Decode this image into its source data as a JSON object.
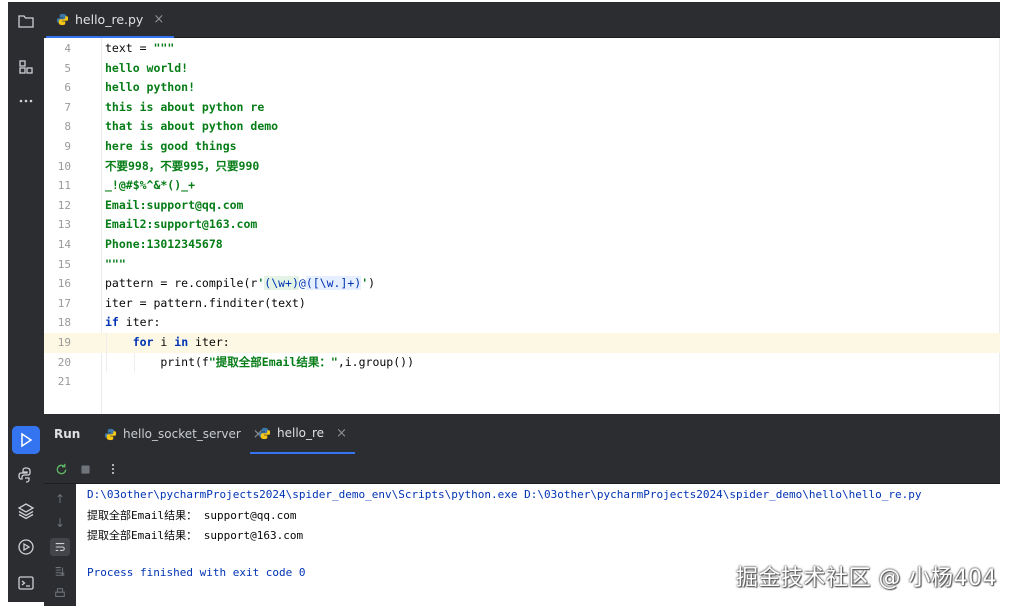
{
  "editor_tab": {
    "filename": "hello_re.py",
    "close": "×"
  },
  "code": [
    {
      "n": "4",
      "parts": [
        [
          "",
          "text = "
        ],
        [
          "str",
          "\"\"\""
        ]
      ]
    },
    {
      "n": "5",
      "parts": [
        [
          "str",
          "hello world!"
        ]
      ]
    },
    {
      "n": "6",
      "parts": [
        [
          "str",
          "hello python!"
        ]
      ]
    },
    {
      "n": "7",
      "parts": [
        [
          "str",
          "this is about python re"
        ]
      ]
    },
    {
      "n": "8",
      "parts": [
        [
          "str",
          "that is about python demo"
        ]
      ]
    },
    {
      "n": "9",
      "parts": [
        [
          "str",
          "here is good things"
        ]
      ]
    },
    {
      "n": "10",
      "parts": [
        [
          "str",
          "不要998，不要995，只要990"
        ]
      ]
    },
    {
      "n": "11",
      "parts": [
        [
          "str",
          "_!@#$%^&*()_+"
        ]
      ]
    },
    {
      "n": "12",
      "parts": [
        [
          "str",
          "Email:support@qq.com"
        ]
      ]
    },
    {
      "n": "13",
      "parts": [
        [
          "str",
          "Email2:support@163.com"
        ]
      ]
    },
    {
      "n": "14",
      "parts": [
        [
          "str",
          "Phone:13012345678"
        ]
      ]
    },
    {
      "n": "15",
      "parts": [
        [
          "str",
          "\"\"\""
        ]
      ]
    },
    {
      "n": "16",
      "parts": [
        [
          "",
          "pattern = re.compile(r"
        ],
        [
          "str",
          "'"
        ],
        [
          "rx-g",
          "(\\w+)"
        ],
        [
          "cw",
          "@"
        ],
        [
          "rx-c",
          "([\\w.]+)"
        ],
        [
          "str",
          "'"
        ],
        [
          "",
          ")"
        ]
      ]
    },
    {
      "n": "17",
      "parts": [
        [
          "",
          "iter = pattern.finditer(text)"
        ]
      ]
    },
    {
      "n": "18",
      "parts": [
        [
          "kw",
          "if"
        ],
        [
          "",
          " iter:"
        ]
      ]
    },
    {
      "n": "19",
      "parts": [
        [
          "",
          "    "
        ],
        [
          "kw",
          "for"
        ],
        [
          "",
          " i "
        ],
        [
          "kw",
          "in"
        ],
        [
          "",
          " iter:"
        ]
      ],
      "current": true
    },
    {
      "n": "20",
      "parts": [
        [
          "",
          "        print(f"
        ],
        [
          "str",
          "\"提取全部Email结果：\""
        ],
        [
          "",
          ",i.group())"
        ]
      ]
    },
    {
      "n": "21",
      "parts": []
    }
  ],
  "run": {
    "title": "Run",
    "tabs": [
      {
        "label": "hello_socket_server",
        "close": "×"
      },
      {
        "label": "hello_re",
        "close": "×"
      }
    ]
  },
  "console": {
    "command": "D:\\03other\\pycharmProjects2024\\spider_demo_env\\Scripts\\python.exe D:\\03other\\pycharmProjects2024\\spider_demo\\hello\\hello_re.py",
    "out1": "提取全部Email结果： support@qq.com",
    "out2": "提取全部Email结果： support@163.com",
    "exit": "Process finished with exit code 0"
  },
  "watermark": "掘金技术社区 @ 小杨404",
  "colors": {
    "accent": "#3574f0",
    "string": "#067d17",
    "keyword": "#0033b3",
    "current_line": "#fcf8e4"
  }
}
